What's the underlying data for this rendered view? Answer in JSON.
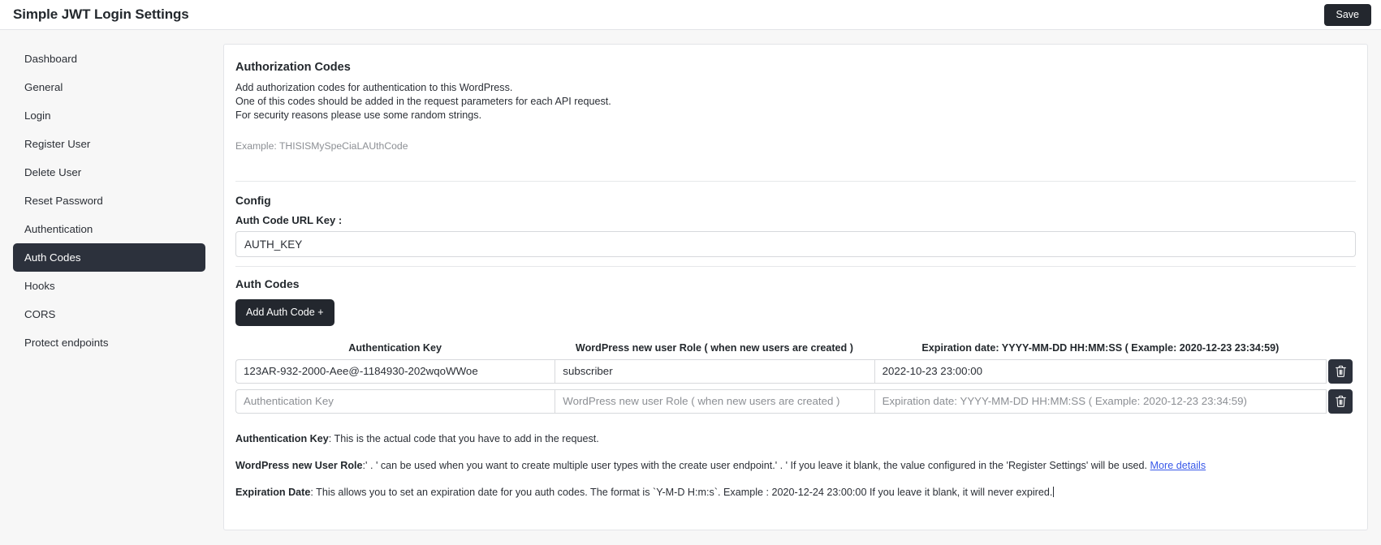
{
  "header": {
    "title": "Simple JWT Login Settings",
    "save_label": "Save"
  },
  "sidebar": {
    "items": [
      {
        "label": "Dashboard",
        "active": false
      },
      {
        "label": "General",
        "active": false
      },
      {
        "label": "Login",
        "active": false
      },
      {
        "label": "Register User",
        "active": false
      },
      {
        "label": "Delete User",
        "active": false
      },
      {
        "label": "Reset Password",
        "active": false
      },
      {
        "label": "Authentication",
        "active": false
      },
      {
        "label": "Auth Codes",
        "active": true
      },
      {
        "label": "Hooks",
        "active": false
      },
      {
        "label": "CORS",
        "active": false
      },
      {
        "label": "Protect endpoints",
        "active": false
      }
    ]
  },
  "main": {
    "section_title": "Authorization Codes",
    "desc_line_1": "Add authorization codes for authentication to this WordPress.",
    "desc_line_2": "One of this codes should be added in the request parameters for each API request.",
    "desc_line_3": "For security reasons please use some random strings.",
    "example": "Example: THISISMySpeCiaLAUthCode",
    "config": {
      "title": "Config",
      "url_key_label": "Auth Code URL Key :",
      "url_key_value": "AUTH_KEY"
    },
    "auth_codes": {
      "title": "Auth Codes",
      "add_button_label": "Add Auth Code +",
      "columns": [
        "Authentication Key",
        "WordPress new user Role ( when new users are created )",
        "Expiration date: YYYY-MM-DD HH:MM:SS ( Example: 2020-12-23 23:34:59)"
      ],
      "rows": [
        {
          "auth_key": "123AR-932-2000-Aee@-1184930-202wqoWWoe",
          "role": "subscriber",
          "expiration": "2022-10-23 23:00:00",
          "delete_icon": "trash-icon"
        },
        {
          "auth_key": "",
          "role": "",
          "expiration": "",
          "delete_icon": "trash-icon"
        }
      ],
      "placeholders": {
        "auth_key": "Authentication Key",
        "role": "WordPress new user Role ( when new users are created )",
        "expiration": "Expiration date: YYYY-MM-DD HH:MM:SS ( Example: 2020-12-23 23:34:59)"
      }
    },
    "notes": {
      "note1_label": "Authentication Key",
      "note1_text": ": This is the actual code that you have to add in the request.",
      "note2_label": "WordPress new User Role",
      "note2_text": ":' . ' can be used when you want to create multiple user types with the create user endpoint.' . ' If you leave it blank, the value configured in the 'Register Settings' will be used. ",
      "note2_link": "More details",
      "note3_label": "Expiration Date",
      "note3_text": ": This allows you to set an expiration date for you auth codes. The format is `Y-M-D H:m:s`. Example : 2020-12-24 23:00:00 If you leave it blank, it will never expired."
    }
  },
  "colors": {
    "accent_dark": "#2c313c",
    "link": "#3858e9",
    "muted": "#8c8f94",
    "border": "#d7d9dc"
  }
}
